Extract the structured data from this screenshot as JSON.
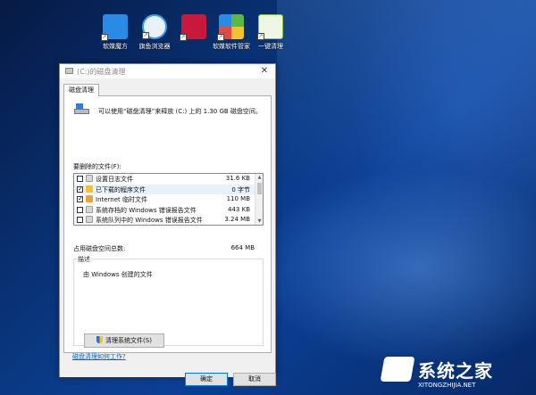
{
  "desktop": {
    "icons": [
      {
        "label": "软媒魔方",
        "icon": "cube-icon",
        "color": "#2a8be6"
      },
      {
        "label": "旗鱼浏览器",
        "icon": "sailfish-icon",
        "color": "#3aa0e8"
      },
      {
        "label": "",
        "icon": "red-app-icon",
        "color": "#c8193c"
      },
      {
        "label": "软媒软件管家",
        "icon": "software-manager-icon",
        "color": "#5ab846"
      },
      {
        "label": "一键清理",
        "icon": "broom-icon",
        "color": "#8cc63f"
      }
    ]
  },
  "window": {
    "title": "(C:)的磁盘清理",
    "tab": "磁盘清理",
    "intro": "可以使用“磁盘清理”来释放 (C:) 上的 1.30 GB 磁盘空间。",
    "files_label": "要删除的文件(F):",
    "files": [
      {
        "checked": false,
        "name": "设置日志文件",
        "size": "31.6 KB",
        "icon_color": "#d7d7d7"
      },
      {
        "checked": true,
        "name": "已下载的程序文件",
        "size": "0 字节",
        "icon_color": "#f2c230"
      },
      {
        "checked": true,
        "name": "Internet 临时文件",
        "size": "110 MB",
        "icon_color": "#e8a33c"
      },
      {
        "checked": false,
        "name": "系统存档的 Windows 错误报告文件",
        "size": "443 KB",
        "icon_color": "#d7d7d7"
      },
      {
        "checked": false,
        "name": "系统队列中的 Windows 错误报告文件",
        "size": "3.24 MB",
        "icon_color": "#d7d7d7"
      }
    ],
    "total_label": "占用磁盘空间总数:",
    "total_value": "664 MB",
    "desc_legend": "描述",
    "desc_text": "由 Windows 创建的文件",
    "clean_system_button": "清理系统文件(S)",
    "help_link": "磁盘清理如何工作?",
    "ok_button": "确定",
    "cancel_button": "取消"
  },
  "watermark": {
    "text": "系统之家",
    "url": "XITONGZHIJIA.NET"
  }
}
